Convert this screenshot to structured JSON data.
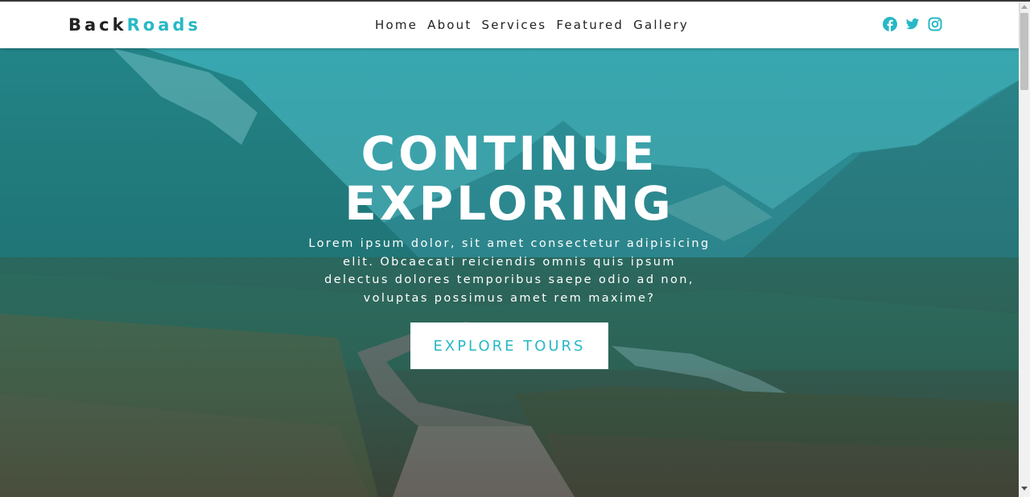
{
  "brand": {
    "part1": "Back",
    "part2": "Roads",
    "accent_color": "#27b8c6"
  },
  "nav": {
    "links": [
      "Home",
      "About",
      "Services",
      "Featured",
      "Gallery"
    ]
  },
  "social": {
    "icons": [
      "facebook-icon",
      "twitter-icon",
      "instagram-icon"
    ]
  },
  "hero": {
    "title_line1": "CONTINUE",
    "title_line2": "EXPLORING",
    "description_lines": [
      "Lorem ipsum dolor, sit amet consectetur adipisicing",
      "elit. Obcaecati reiciendis omnis quis ipsum",
      "delectus dolores temporibus saepe odio ad non,",
      "voluptas possimus amet rem maxime?"
    ],
    "button_label": "EXPLORE TOURS",
    "overlay_color": "#2ab6c0"
  }
}
